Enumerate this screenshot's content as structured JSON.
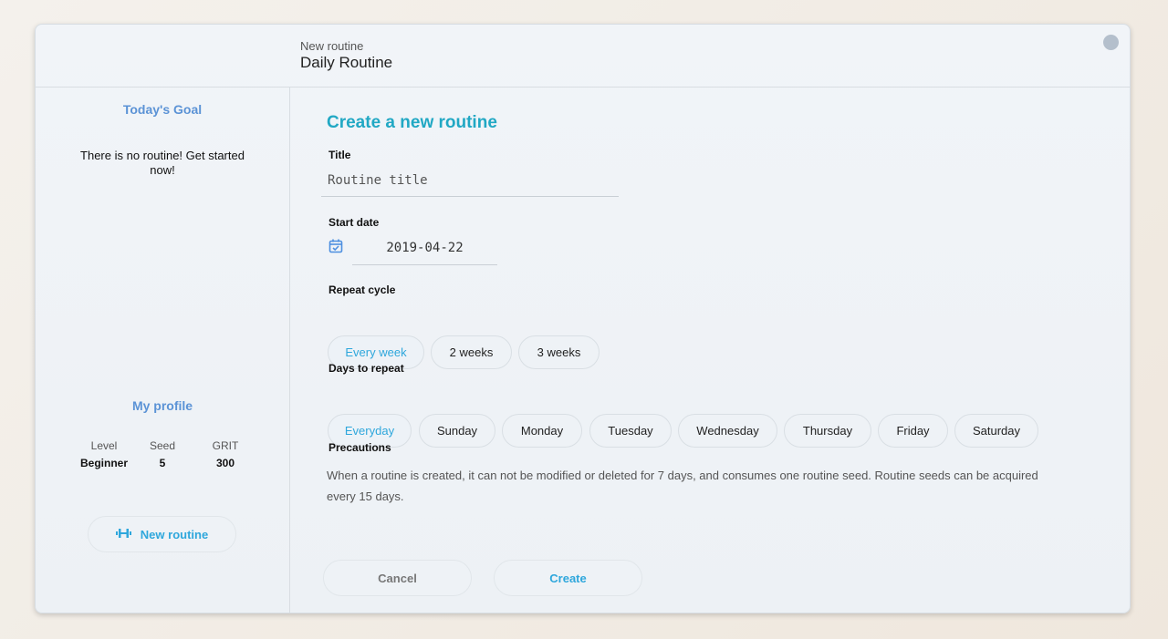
{
  "header": {
    "subtitle": "New routine",
    "title": "Daily Routine"
  },
  "sidebar": {
    "goal_heading": "Today's Goal",
    "empty_message": "There is no routine! Get started now!",
    "profile_heading": "My profile",
    "stats": [
      {
        "label": "Level",
        "value": "Beginner"
      },
      {
        "label": "Seed",
        "value": "5"
      },
      {
        "label": "GRIT",
        "value": "300"
      }
    ],
    "new_routine_label": "New routine",
    "new_routine_icon": "dumbbell-icon"
  },
  "form": {
    "heading": "Create a new routine",
    "title_label": "Title",
    "title_placeholder": "Routine title",
    "start_date_label": "Start date",
    "start_date_value": "2019-04-22",
    "calendar_icon": "calendar-check-icon",
    "repeat_cycle_label": "Repeat cycle",
    "repeat_cycles": [
      "Every week",
      "2 weeks",
      "3 weeks"
    ],
    "selected_cycle": "Every week",
    "days_label": "Days to repeat",
    "days": [
      "Everyday",
      "Sunday",
      "Monday",
      "Tuesday",
      "Wednesday",
      "Thursday",
      "Friday",
      "Saturday"
    ],
    "selected_day": "Everyday",
    "precautions_label": "Precautions",
    "precautions_text": "When a routine is created, it can not be modified or deleted for 7 days, and consumes one routine seed. Routine seeds can be acquired every 15 days.",
    "cancel_label": "Cancel",
    "create_label": "Create"
  },
  "colors": {
    "accent": "#2ea7dc",
    "heading": "#21a8c4",
    "sidebar_heading": "#5b93d6"
  }
}
